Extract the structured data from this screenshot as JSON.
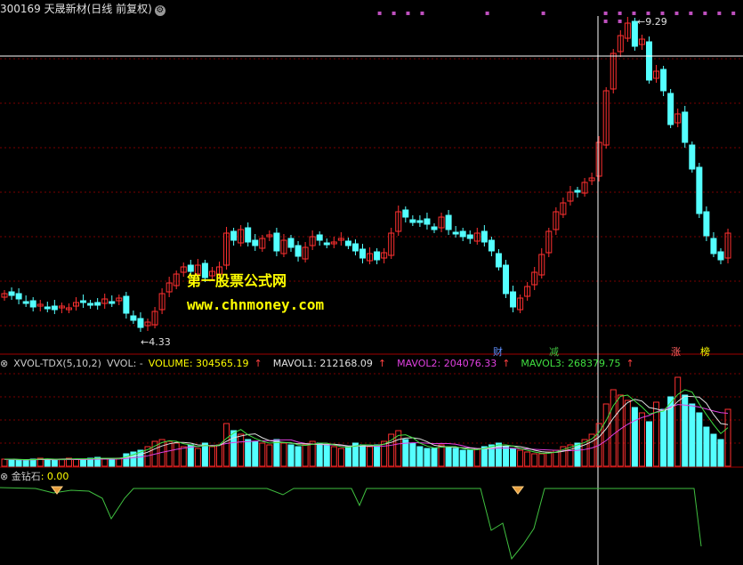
{
  "header": {
    "title": "300169 天晟新材(日线 前复权)",
    "settings_icon": "gear-icon"
  },
  "price_chart": {
    "high_label": "9.29",
    "low_label": "4.33",
    "crosshair_price_visible": true
  },
  "watermark": {
    "line1": "第一股票公式网",
    "line2": "www.chnmoney.com"
  },
  "events": [
    {
      "label": "财",
      "color": "#6090ff"
    },
    {
      "label": "减",
      "color": "#40c040"
    },
    {
      "label": "涨",
      "color": "#ff6060"
    },
    {
      "label": "榜",
      "color": "#ffff00"
    }
  ],
  "volume_panel": {
    "indicator": "XVOL-TDX(5,10,2)",
    "vvol": "VVOL: -",
    "volume": "VOLUME: 304565.19",
    "mavol1": "MAVOL1: 212168.09",
    "mavol2": "MAVOL2: 204076.33",
    "mavol3": "MAVOL3: 268379.75",
    "colors": {
      "volume": "#ffff00",
      "mavol1": "#e0e0e0",
      "mavol2": "#e040e0",
      "mavol3": "#40e040",
      "arrow": "#ff4040"
    }
  },
  "jzs_panel": {
    "name": "金钻石",
    "value": ": 0.00",
    "diamond_icon": "diamond-icon"
  },
  "colors": {
    "up": "#ff3030",
    "down": "#54ffff",
    "grid": "#7a0000",
    "crosshair": "#ffffff"
  }
}
